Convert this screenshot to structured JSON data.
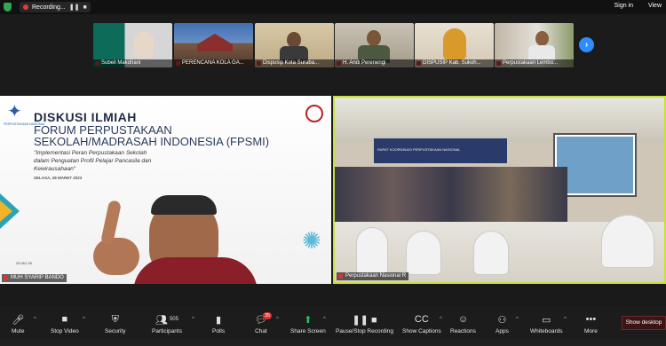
{
  "topbar": {
    "recording_label": "Recording...",
    "signin_label": "Sign in",
    "view_label": "View"
  },
  "participants": [
    {
      "name": "Subeil Makdriani"
    },
    {
      "name": "PERENCANA KOLA GA..."
    },
    {
      "name": "Dispusip Kota Suraba..."
    },
    {
      "name": "H. Andi Perenengi"
    },
    {
      "name": "DISPUSIP Kab. Sukoh..."
    },
    {
      "name": "Perpustakaan Lembo..."
    }
  ],
  "slide": {
    "title1": "DISKUSI ILMIAH",
    "title2": "FORUM PERPUSTAKAAN",
    "title3": "SEKOLAH/MADRASAH INDONESIA (FPSMI)",
    "subtitle1": "\"Implementasi Peran Perpustakaan Sekolah",
    "subtitle2": "dalam Penguatan Profil Pelajar Pancasila dan",
    "subtitle3": "Kewirausahaan\"",
    "date": "SELASA, 28 MARET 2023",
    "logo_text": "PERPUSTAKAAN NASIONAL",
    "time_small": "25.061.35"
  },
  "speaker": {
    "name": "MUH SYARIP BANDO"
  },
  "room": {
    "name": "Perpustakaan Nasional R",
    "banner": "RAPAT KOORDINASI PERPUSTAKAAN NASIONAL"
  },
  "toolbar": {
    "mute": "Mute",
    "video": "Stop Video",
    "security": "Security",
    "participants": "Participants",
    "participants_count": "505",
    "polls": "Polls",
    "chat": "Chat",
    "chat_badge": "35",
    "share": "Share Screen",
    "record": "Pause/Stop Recording",
    "captions": "Show Captions",
    "reactions": "Reactions",
    "apps": "Apps",
    "whiteboards": "Whiteboards",
    "more": "More",
    "show_desktop": "Show desktop"
  },
  "colors": {
    "accent": "#2d8cff",
    "active_border": "#c8e03a",
    "share_green": "#21c25e",
    "alert_red": "#e02d2d"
  }
}
